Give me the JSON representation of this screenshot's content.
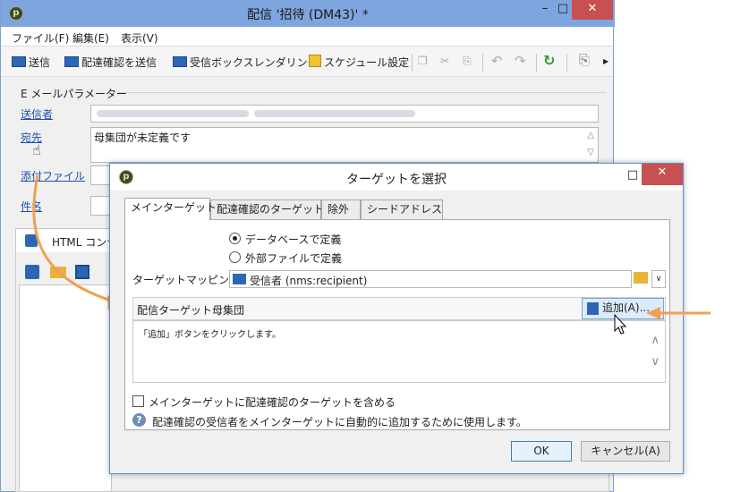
{
  "main_window": {
    "title": "配信 '招待 (DM43)' *",
    "menu": [
      "ファイル(F)",
      "編集(E)",
      "表示(V)"
    ],
    "toolbar": {
      "send": "送信",
      "proof_send": "配達確認を送信",
      "inbox_render": "受信ボックスレンダリング",
      "schedule": "スケジュール設定"
    },
    "email_params_label": "E メールパラメーター",
    "from_label": "送信者",
    "to_label": "宛先",
    "to_value": "母集団が未定義です",
    "attachment_label": "添付ファイル",
    "subject_label": "件名",
    "html_tab_label": "HTML コンテ"
  },
  "dialog": {
    "title": "ターゲットを選択",
    "tabs": [
      "メインターゲット",
      "配達確認のターゲット",
      "除外",
      "シードアドレス"
    ],
    "radio_db": "データベースで定義",
    "radio_file": "外部ファイルで定義",
    "mapping_label": "ターゲットマッピング:",
    "mapping_value": "受信者 (nms:recipient)",
    "population_label": "配信ターゲット母集団",
    "add_button": "追加(A)...",
    "hint_text": "「追加」ボタンをクリックします。",
    "checkbox_label": "メインターゲットに配達確認のターゲットを含める",
    "help_text": "配達確認の受信者をメインターゲットに自動的に追加するために使用します。",
    "ok_button": "OK",
    "cancel_button": "キャンセル(A)"
  },
  "colors": {
    "accent_blue": "#1a4fb0",
    "arrow_orange": "#f0a050",
    "close_red": "#c75050"
  }
}
